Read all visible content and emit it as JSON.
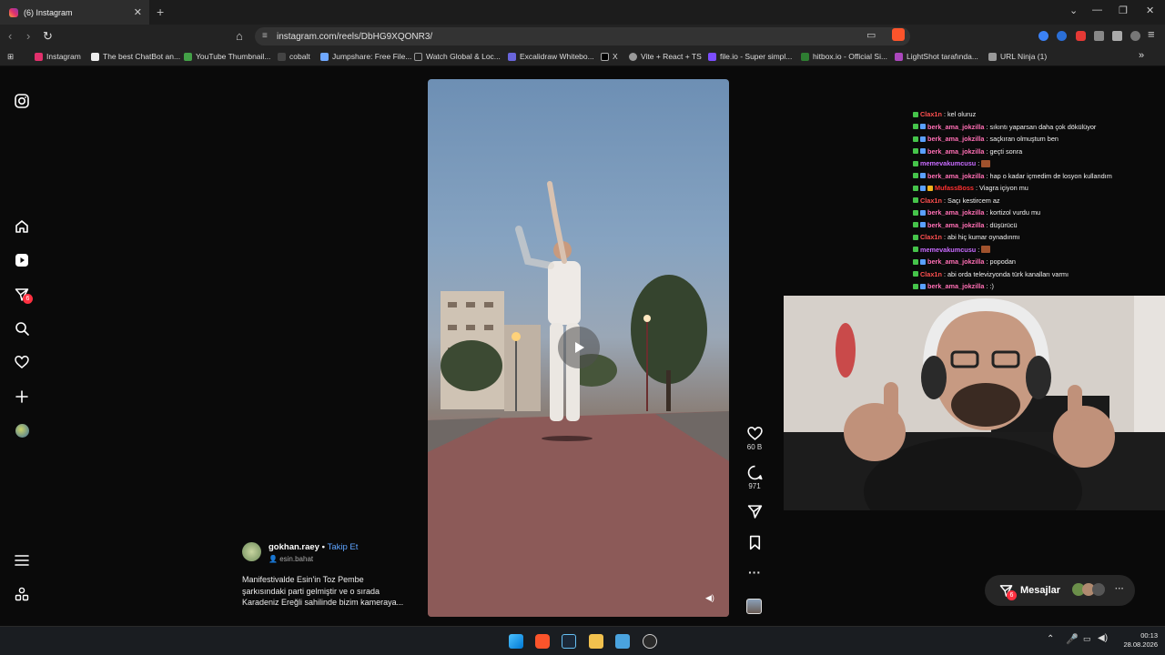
{
  "browser": {
    "tab_title": "(6) Instagram",
    "new_tab": "+",
    "url": "instagram.com/reels/DbHG9XQONR3/",
    "bookmarks": [
      "Instagram",
      "The best ChatBot an...",
      "YouTube Thumbnail...",
      "cobalt",
      "Jumpshare: Free File...",
      "Watch Global & Loc...",
      "Excalidraw Whitebo...",
      "X",
      "Vite + React + TS",
      "file.io - Super simpl...",
      "hitbox.io - Official Si...",
      "LightShot tarafında...",
      "URL Ninja (1)"
    ]
  },
  "instagram": {
    "notification_badge": "6",
    "post": {
      "username": "gokhan.raey",
      "separator": "•",
      "follow": "Takip Et",
      "collaborator": "esin.bahat",
      "caption_lines": [
        "Manifestivalde Esin'in Toz Pembe",
        "şarkısındaki parti gelmiştir ve o sırada",
        "Karadeniz Ereğli sahilinde bizim kameraya..."
      ]
    },
    "actions": {
      "likes": "60 B",
      "comments": "971"
    },
    "messages": {
      "label": "Mesajlar",
      "badge": "6"
    }
  },
  "chat": [
    {
      "user": "Clax1n",
      "color": "#ff4f4f",
      "msg": "kel oluruz"
    },
    {
      "user": "berk_ama_jokzilla",
      "color": "#ff6fb4",
      "msg": "sıkıntı yaparsan daha çok dökülüyor"
    },
    {
      "user": "berk_ama_jokzilla",
      "color": "#ff6fb4",
      "msg": "saçkıran olmuştum ben"
    },
    {
      "user": "berk_ama_jokzilla",
      "color": "#ff6fb4",
      "msg": "geçti sonra"
    },
    {
      "user": "memevakumcusu",
      "color": "#c86bff",
      "msg": ""
    },
    {
      "user": "berk_ama_jokzilla",
      "color": "#ff6fb4",
      "msg": "hap o kadar içmedim de losyon kullandım"
    },
    {
      "user": "MufassBoss",
      "color": "#ff3030",
      "msg": "Viagra içiyon mu"
    },
    {
      "user": "Clax1n",
      "color": "#ff4f4f",
      "msg": "Saçı kestircem az"
    },
    {
      "user": "berk_ama_jokzilla",
      "color": "#ff6fb4",
      "msg": "kortizol vurdu mu"
    },
    {
      "user": "berk_ama_jokzilla",
      "color": "#ff6fb4",
      "msg": "düşürücü"
    },
    {
      "user": "Clax1n",
      "color": "#ff4f4f",
      "msg": "abi hiç kumar oynadınmı"
    },
    {
      "user": "memevakumcusu",
      "color": "#c86bff",
      "msg": ""
    },
    {
      "user": "berk_ama_jokzilla",
      "color": "#ff6fb4",
      "msg": "popodan"
    },
    {
      "user": "Clax1n",
      "color": "#ff4f4f",
      "msg": "abi orda televizyonda türk kanalları varmı"
    },
    {
      "user": "berk_ama_jokzilla",
      "color": "#ff6fb4",
      "msg": ":)"
    }
  ],
  "taskbar": {
    "time": "00:13",
    "date": "28.08.2026"
  }
}
